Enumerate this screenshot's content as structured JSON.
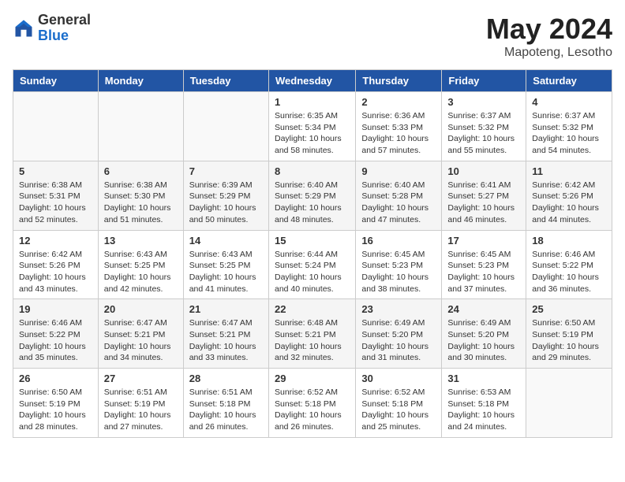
{
  "header": {
    "logo_general": "General",
    "logo_blue": "Blue",
    "month_year": "May 2024",
    "location": "Mapoteng, Lesotho"
  },
  "weekdays": [
    "Sunday",
    "Monday",
    "Tuesday",
    "Wednesday",
    "Thursday",
    "Friday",
    "Saturday"
  ],
  "weeks": [
    [
      {
        "day": "",
        "info": ""
      },
      {
        "day": "",
        "info": ""
      },
      {
        "day": "",
        "info": ""
      },
      {
        "day": "1",
        "info": "Sunrise: 6:35 AM\nSunset: 5:34 PM\nDaylight: 10 hours\nand 58 minutes."
      },
      {
        "day": "2",
        "info": "Sunrise: 6:36 AM\nSunset: 5:33 PM\nDaylight: 10 hours\nand 57 minutes."
      },
      {
        "day": "3",
        "info": "Sunrise: 6:37 AM\nSunset: 5:32 PM\nDaylight: 10 hours\nand 55 minutes."
      },
      {
        "day": "4",
        "info": "Sunrise: 6:37 AM\nSunset: 5:32 PM\nDaylight: 10 hours\nand 54 minutes."
      }
    ],
    [
      {
        "day": "5",
        "info": "Sunrise: 6:38 AM\nSunset: 5:31 PM\nDaylight: 10 hours\nand 52 minutes."
      },
      {
        "day": "6",
        "info": "Sunrise: 6:38 AM\nSunset: 5:30 PM\nDaylight: 10 hours\nand 51 minutes."
      },
      {
        "day": "7",
        "info": "Sunrise: 6:39 AM\nSunset: 5:29 PM\nDaylight: 10 hours\nand 50 minutes."
      },
      {
        "day": "8",
        "info": "Sunrise: 6:40 AM\nSunset: 5:29 PM\nDaylight: 10 hours\nand 48 minutes."
      },
      {
        "day": "9",
        "info": "Sunrise: 6:40 AM\nSunset: 5:28 PM\nDaylight: 10 hours\nand 47 minutes."
      },
      {
        "day": "10",
        "info": "Sunrise: 6:41 AM\nSunset: 5:27 PM\nDaylight: 10 hours\nand 46 minutes."
      },
      {
        "day": "11",
        "info": "Sunrise: 6:42 AM\nSunset: 5:26 PM\nDaylight: 10 hours\nand 44 minutes."
      }
    ],
    [
      {
        "day": "12",
        "info": "Sunrise: 6:42 AM\nSunset: 5:26 PM\nDaylight: 10 hours\nand 43 minutes."
      },
      {
        "day": "13",
        "info": "Sunrise: 6:43 AM\nSunset: 5:25 PM\nDaylight: 10 hours\nand 42 minutes."
      },
      {
        "day": "14",
        "info": "Sunrise: 6:43 AM\nSunset: 5:25 PM\nDaylight: 10 hours\nand 41 minutes."
      },
      {
        "day": "15",
        "info": "Sunrise: 6:44 AM\nSunset: 5:24 PM\nDaylight: 10 hours\nand 40 minutes."
      },
      {
        "day": "16",
        "info": "Sunrise: 6:45 AM\nSunset: 5:23 PM\nDaylight: 10 hours\nand 38 minutes."
      },
      {
        "day": "17",
        "info": "Sunrise: 6:45 AM\nSunset: 5:23 PM\nDaylight: 10 hours\nand 37 minutes."
      },
      {
        "day": "18",
        "info": "Sunrise: 6:46 AM\nSunset: 5:22 PM\nDaylight: 10 hours\nand 36 minutes."
      }
    ],
    [
      {
        "day": "19",
        "info": "Sunrise: 6:46 AM\nSunset: 5:22 PM\nDaylight: 10 hours\nand 35 minutes."
      },
      {
        "day": "20",
        "info": "Sunrise: 6:47 AM\nSunset: 5:21 PM\nDaylight: 10 hours\nand 34 minutes."
      },
      {
        "day": "21",
        "info": "Sunrise: 6:47 AM\nSunset: 5:21 PM\nDaylight: 10 hours\nand 33 minutes."
      },
      {
        "day": "22",
        "info": "Sunrise: 6:48 AM\nSunset: 5:21 PM\nDaylight: 10 hours\nand 32 minutes."
      },
      {
        "day": "23",
        "info": "Sunrise: 6:49 AM\nSunset: 5:20 PM\nDaylight: 10 hours\nand 31 minutes."
      },
      {
        "day": "24",
        "info": "Sunrise: 6:49 AM\nSunset: 5:20 PM\nDaylight: 10 hours\nand 30 minutes."
      },
      {
        "day": "25",
        "info": "Sunrise: 6:50 AM\nSunset: 5:19 PM\nDaylight: 10 hours\nand 29 minutes."
      }
    ],
    [
      {
        "day": "26",
        "info": "Sunrise: 6:50 AM\nSunset: 5:19 PM\nDaylight: 10 hours\nand 28 minutes."
      },
      {
        "day": "27",
        "info": "Sunrise: 6:51 AM\nSunset: 5:19 PM\nDaylight: 10 hours\nand 27 minutes."
      },
      {
        "day": "28",
        "info": "Sunrise: 6:51 AM\nSunset: 5:18 PM\nDaylight: 10 hours\nand 26 minutes."
      },
      {
        "day": "29",
        "info": "Sunrise: 6:52 AM\nSunset: 5:18 PM\nDaylight: 10 hours\nand 26 minutes."
      },
      {
        "day": "30",
        "info": "Sunrise: 6:52 AM\nSunset: 5:18 PM\nDaylight: 10 hours\nand 25 minutes."
      },
      {
        "day": "31",
        "info": "Sunrise: 6:53 AM\nSunset: 5:18 PM\nDaylight: 10 hours\nand 24 minutes."
      },
      {
        "day": "",
        "info": ""
      }
    ]
  ]
}
